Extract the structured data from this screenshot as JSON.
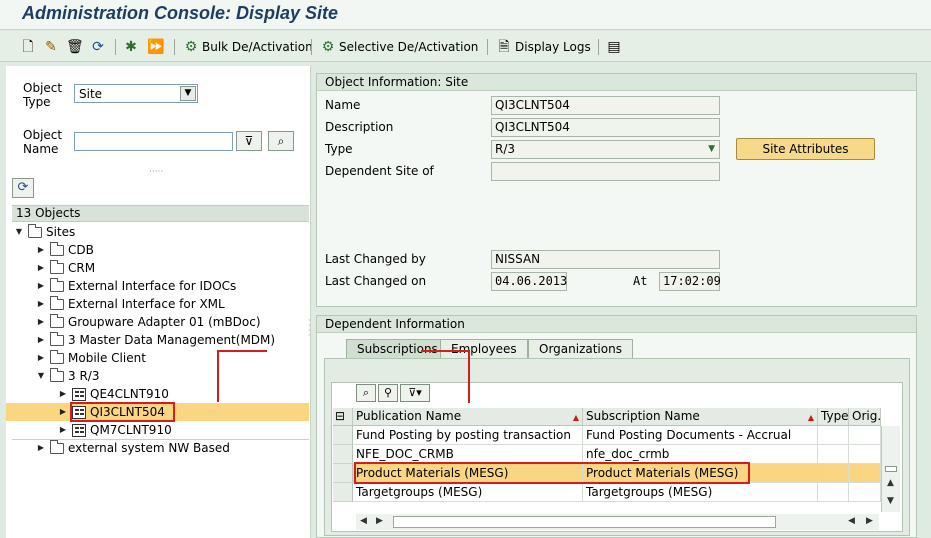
{
  "window": {
    "title": "Administration Console: Display Site"
  },
  "toolbar": {
    "icons": [
      "new-icon",
      "edit-icon",
      "delete-icon",
      "refresh-icon",
      "activate-icon",
      "execute-icon"
    ],
    "bulk_label": "Bulk De/Activation",
    "selective_label": "Selective De/Activation",
    "logs_label": "Display Logs"
  },
  "left": {
    "object_type_label_1": "Object",
    "object_type_label_2": "Type",
    "object_type_value": "Site",
    "object_name_label_1": "Object",
    "object_name_label_2": "Name",
    "object_name_value": "",
    "objects_count": "13 Objects",
    "tree": {
      "root": "Sites",
      "items": [
        "CDB",
        "CRM",
        "External Interface for IDOCs",
        "External Interface for XML",
        "Groupware Adapter 01 (mBDoc)",
        "3 Master Data Management(MDM)",
        "Mobile Client",
        "3 R/3"
      ],
      "r3_children": [
        "QE4CLNT910",
        "QI3CLNT504",
        "QM7CLNT910"
      ],
      "last": "external system NW Based"
    }
  },
  "object_info": {
    "title": "Object Information: Site",
    "name_label": "Name",
    "name_value": "QI3CLNT504",
    "description_label": "Description",
    "description_value": "QI3CLNT504",
    "type_label": "Type",
    "type_value": "R/3",
    "dependent_label": "Dependent Site of",
    "dependent_value": "",
    "site_attributes": "Site Attributes",
    "changed_by_label": "Last Changed by",
    "changed_by_value": "NISSAN",
    "changed_on_label": "Last Changed on",
    "changed_on_value": "04.06.2013",
    "at_label": "At",
    "at_value": "17:02:09"
  },
  "dependent": {
    "title": "Dependent Information",
    "tabs": [
      "Subscriptions",
      "Employees",
      "Organizations"
    ],
    "columns": [
      "Publication Name",
      "Subscription Name",
      "Type",
      "Orig."
    ],
    "rows": [
      [
        "Fund Posting by posting transaction",
        "Fund Posting Documents - Accrual"
      ],
      [
        "NFE_DOC_CRMB",
        "nfe_doc_crmb"
      ],
      [
        "Product Materials (MESG)",
        "Product Materials (MESG)"
      ],
      [
        "Targetgroups (MESG)",
        "Targetgroups (MESG)"
      ]
    ]
  },
  "colors": {
    "highlight": "#fbd682",
    "annotation_red": "#d41e1e",
    "title_blue": "#1c3e64"
  }
}
